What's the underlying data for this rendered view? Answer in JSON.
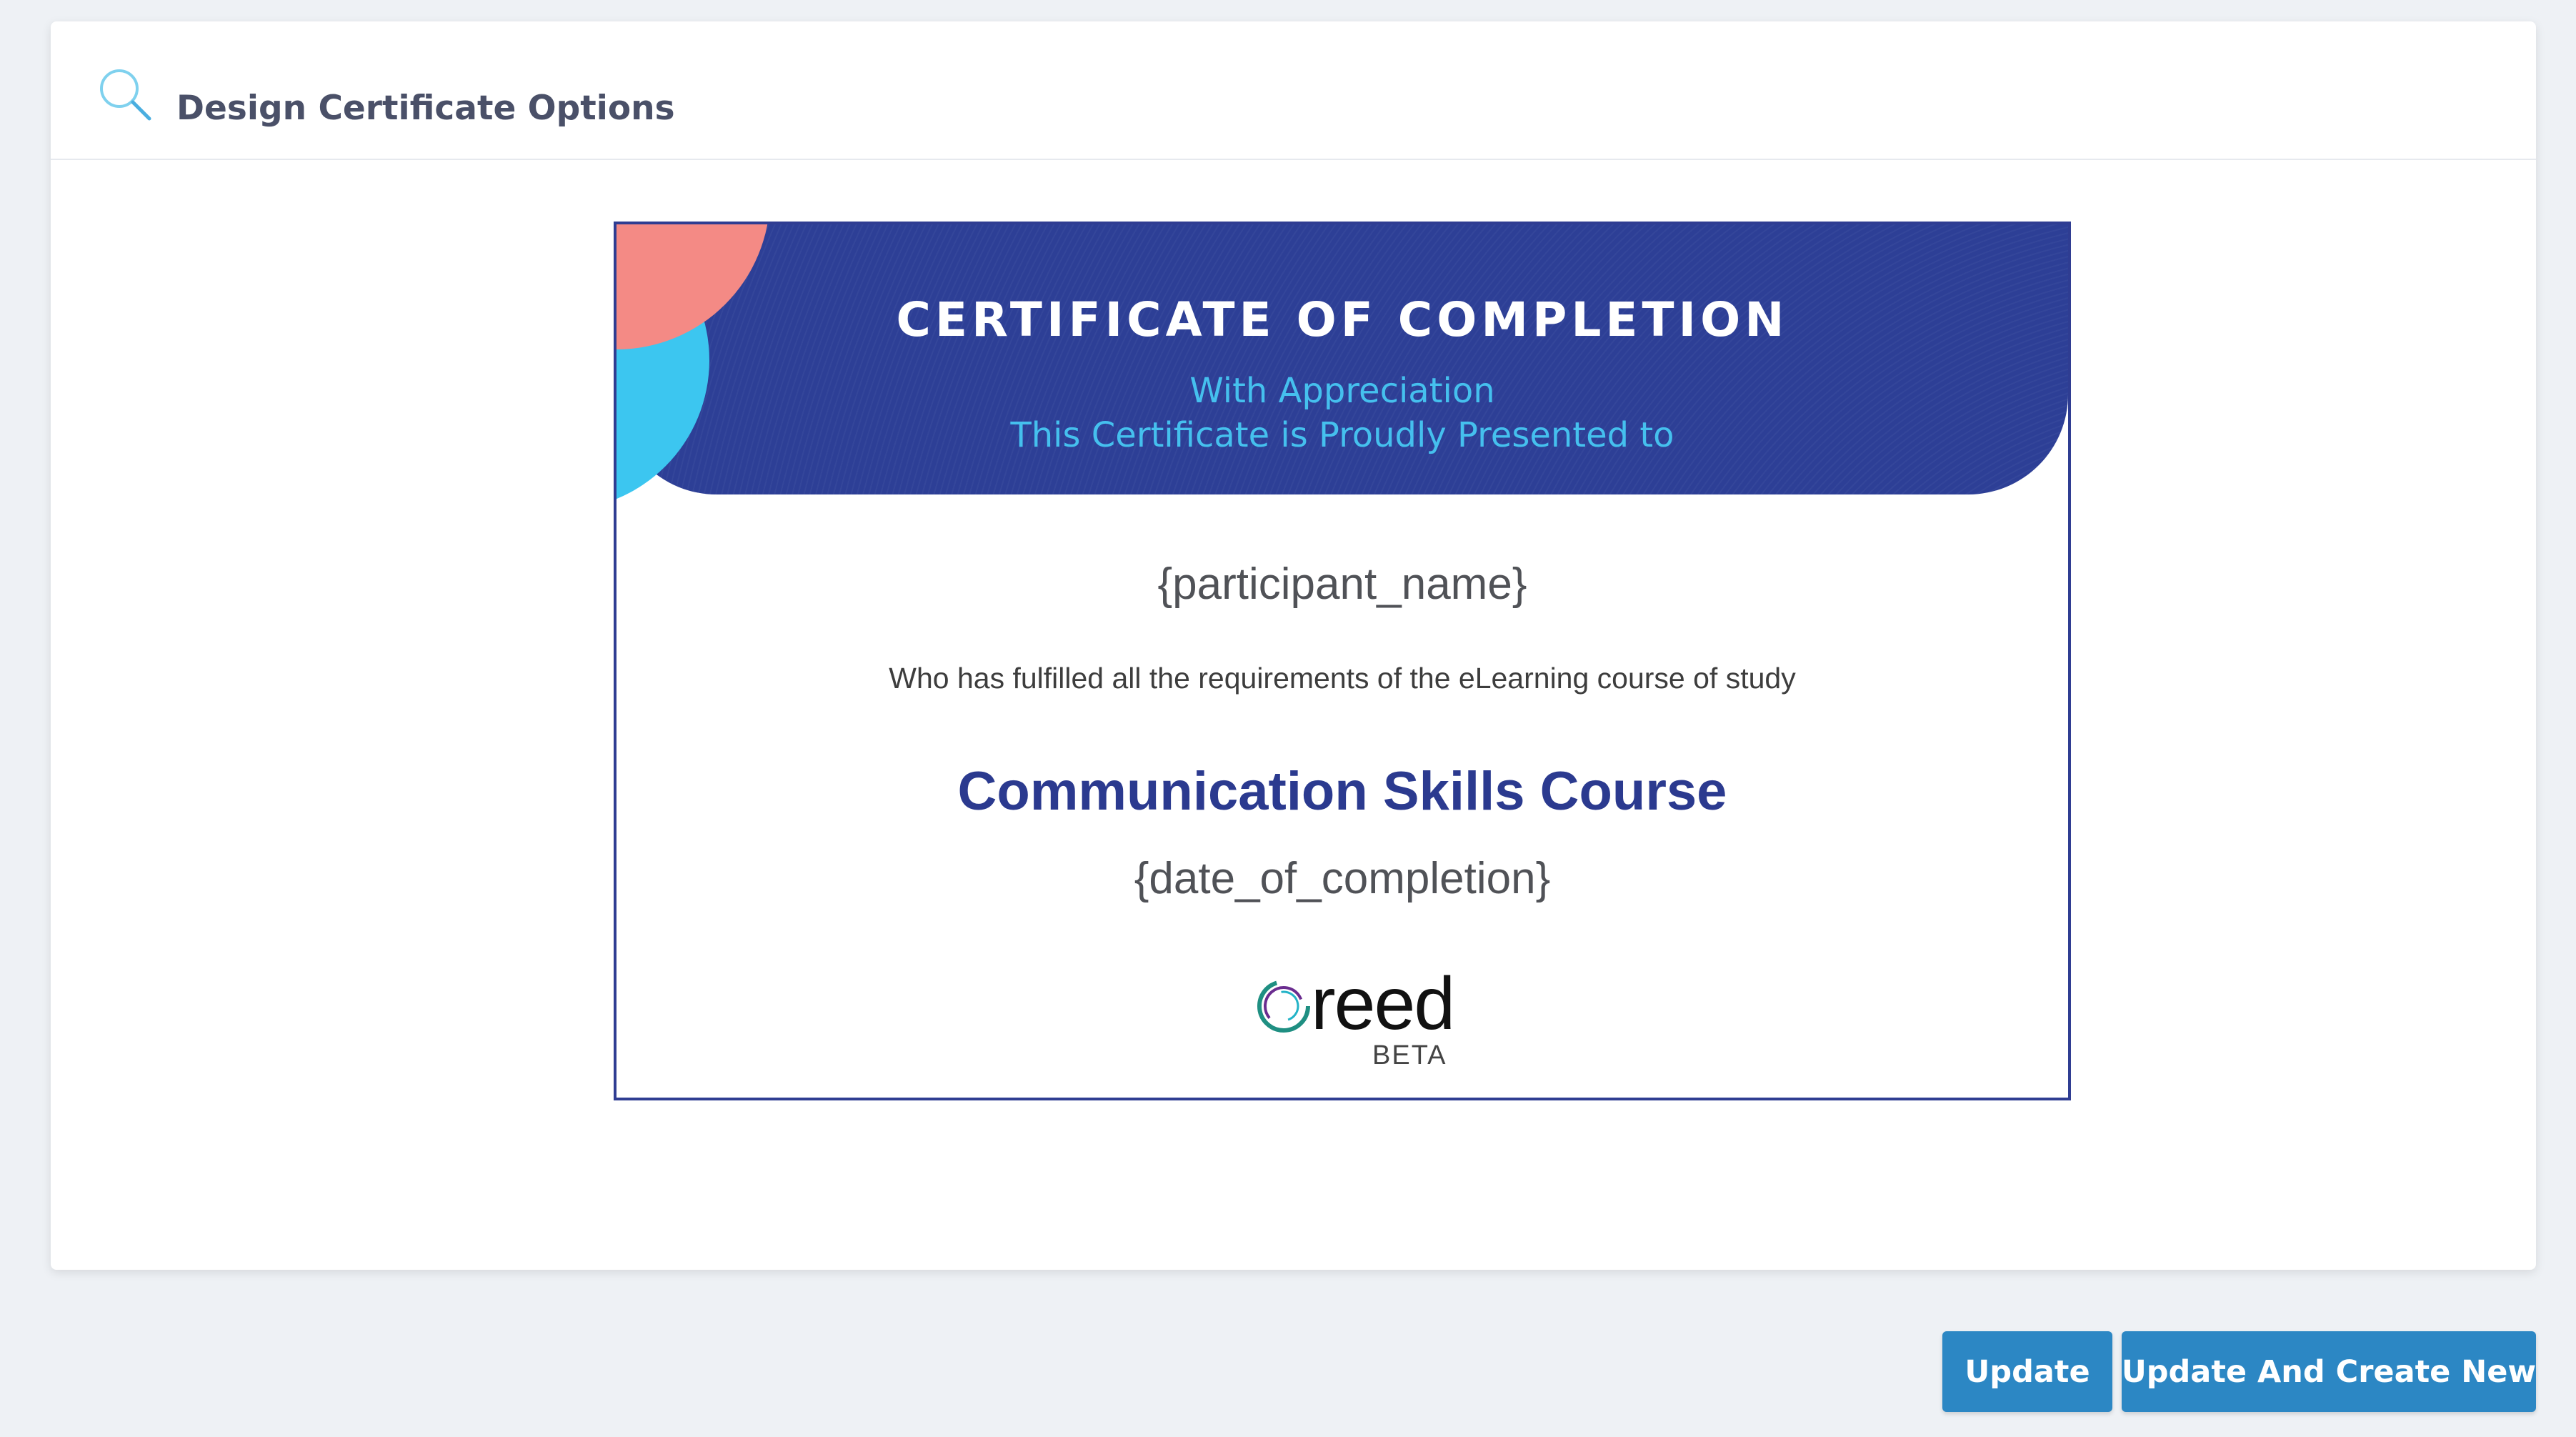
{
  "header": {
    "title": "Design Certificate Options",
    "icon": "search-icon"
  },
  "certificate": {
    "title": "CERTIFICATE OF COMPLETION",
    "subtitle_line1": "With Appreciation",
    "subtitle_line2": "This Certificate is Proudly Presented to",
    "participant_placeholder": "{participant_name}",
    "requirement_text": "Who has fulfilled all the requirements of the eLearning course of study",
    "course_name": "Communication Skills Course",
    "date_placeholder": "{date_of_completion}",
    "logo": {
      "wordmark": "reed",
      "tag": "BETA"
    }
  },
  "actions": {
    "update_label": "Update",
    "update_create_label": "Update And Create New"
  },
  "colors": {
    "banner": "#2d3f96",
    "accent_light_blue": "#45c0ee",
    "accent_coral": "#f48a85",
    "course_text": "#2b3a8f",
    "button": "#2c87c4"
  }
}
